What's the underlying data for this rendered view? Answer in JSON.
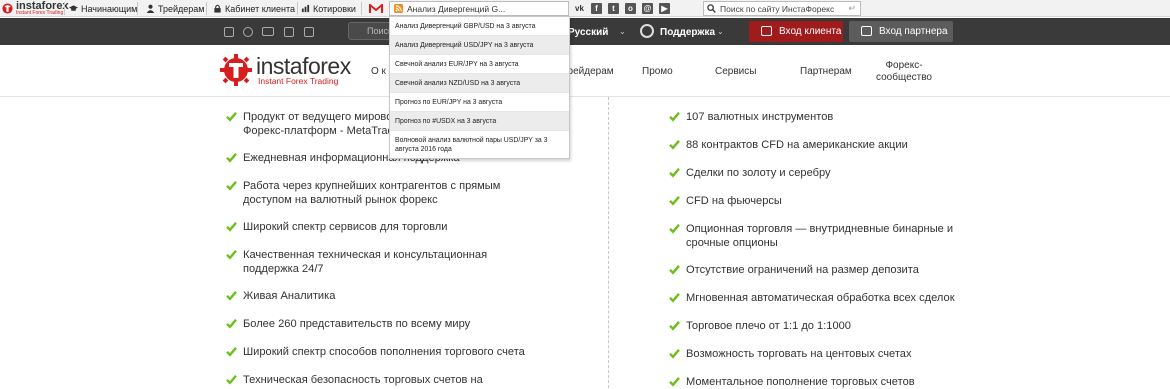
{
  "toolbar": {
    "logo_name": "instaforex",
    "logo_tagline": "Instant Forex Trading",
    "items": [
      "Начинающим",
      "Трейдерам",
      "Кабинет клиента",
      "Котировки"
    ],
    "rss_value": "Анализ Дивергенций G...",
    "social_icons": [
      "vk-icon",
      "facebook-icon",
      "twitter-icon",
      "odnoklassniki-icon",
      "moimir-icon",
      "youtube-icon"
    ],
    "search_placeholder": "Поиск по сайту ИнстаФорекс"
  },
  "topbar": {
    "search_label": "Поиск",
    "language": "Русский",
    "support": "Поддержка",
    "client_login": "Вход клиента",
    "partner_login": "Вход партнера"
  },
  "header": {
    "logo_name": "instaforex",
    "logo_tagline": "Instant Forex Trading",
    "nav": [
      "О к",
      "Трейдерам",
      "Промо",
      "Сервисы",
      "Партнерам"
    ],
    "nav_community": [
      "Форекс-",
      "сообщество"
    ]
  },
  "dropdown": [
    "Анализ Дивергенций GBP/USD на 3 августа",
    "Анализ Дивергенций USD/JPY на 3 августа",
    "Свечной анализ EUR/JPY на 3 августа",
    "Свечной анализ NZD/USD на 3 августа",
    "Прогноз по EUR/JPY на 3 августа",
    "Прогноз по #USDX на 3 августа",
    "Волновой анализ валютной пары USD/JPY за 3 августа 2016 года"
  ],
  "features_left": [
    "Продукт от ведущего мирового\nФорекс-платформ - MetaTrade",
    "Ежедневная информационная поддержка",
    "Работа через крупнейших контрагентов с прямым\nдоступом на валютный рынок форекс",
    "Широкий спектр сервисов для торговли",
    "Качественная техническая и консультационная\nподдержка 24/7",
    "Живая Аналитика",
    "Более 260 представительств по всему миру",
    "Широкий спектр способов пополнения торгового счета",
    "Техническая безопасность торговых счетов на"
  ],
  "features_right": [
    "107 валютных инструментов",
    "88 контрактов CFD на американские акции",
    "Сделки по золоту и серебру",
    "CFD на фьючерсы",
    "Опционная торговля — внутридневные бинарные и\nсрочные опционы",
    "Отсутствие ограничений на размер депозита",
    "Мгновенная автоматическая обработка всех сделок",
    "Торговое плечо от 1:1 до 1:1000",
    "Возможность торговать на центовых счетах",
    "Моментальное пополнение торговых счетов"
  ],
  "colors": {
    "brand_red": "#d71e1e",
    "check_green": "#6cbf1c",
    "dark_bar": "#3a3a3a",
    "client_button": "#a01c1c"
  }
}
